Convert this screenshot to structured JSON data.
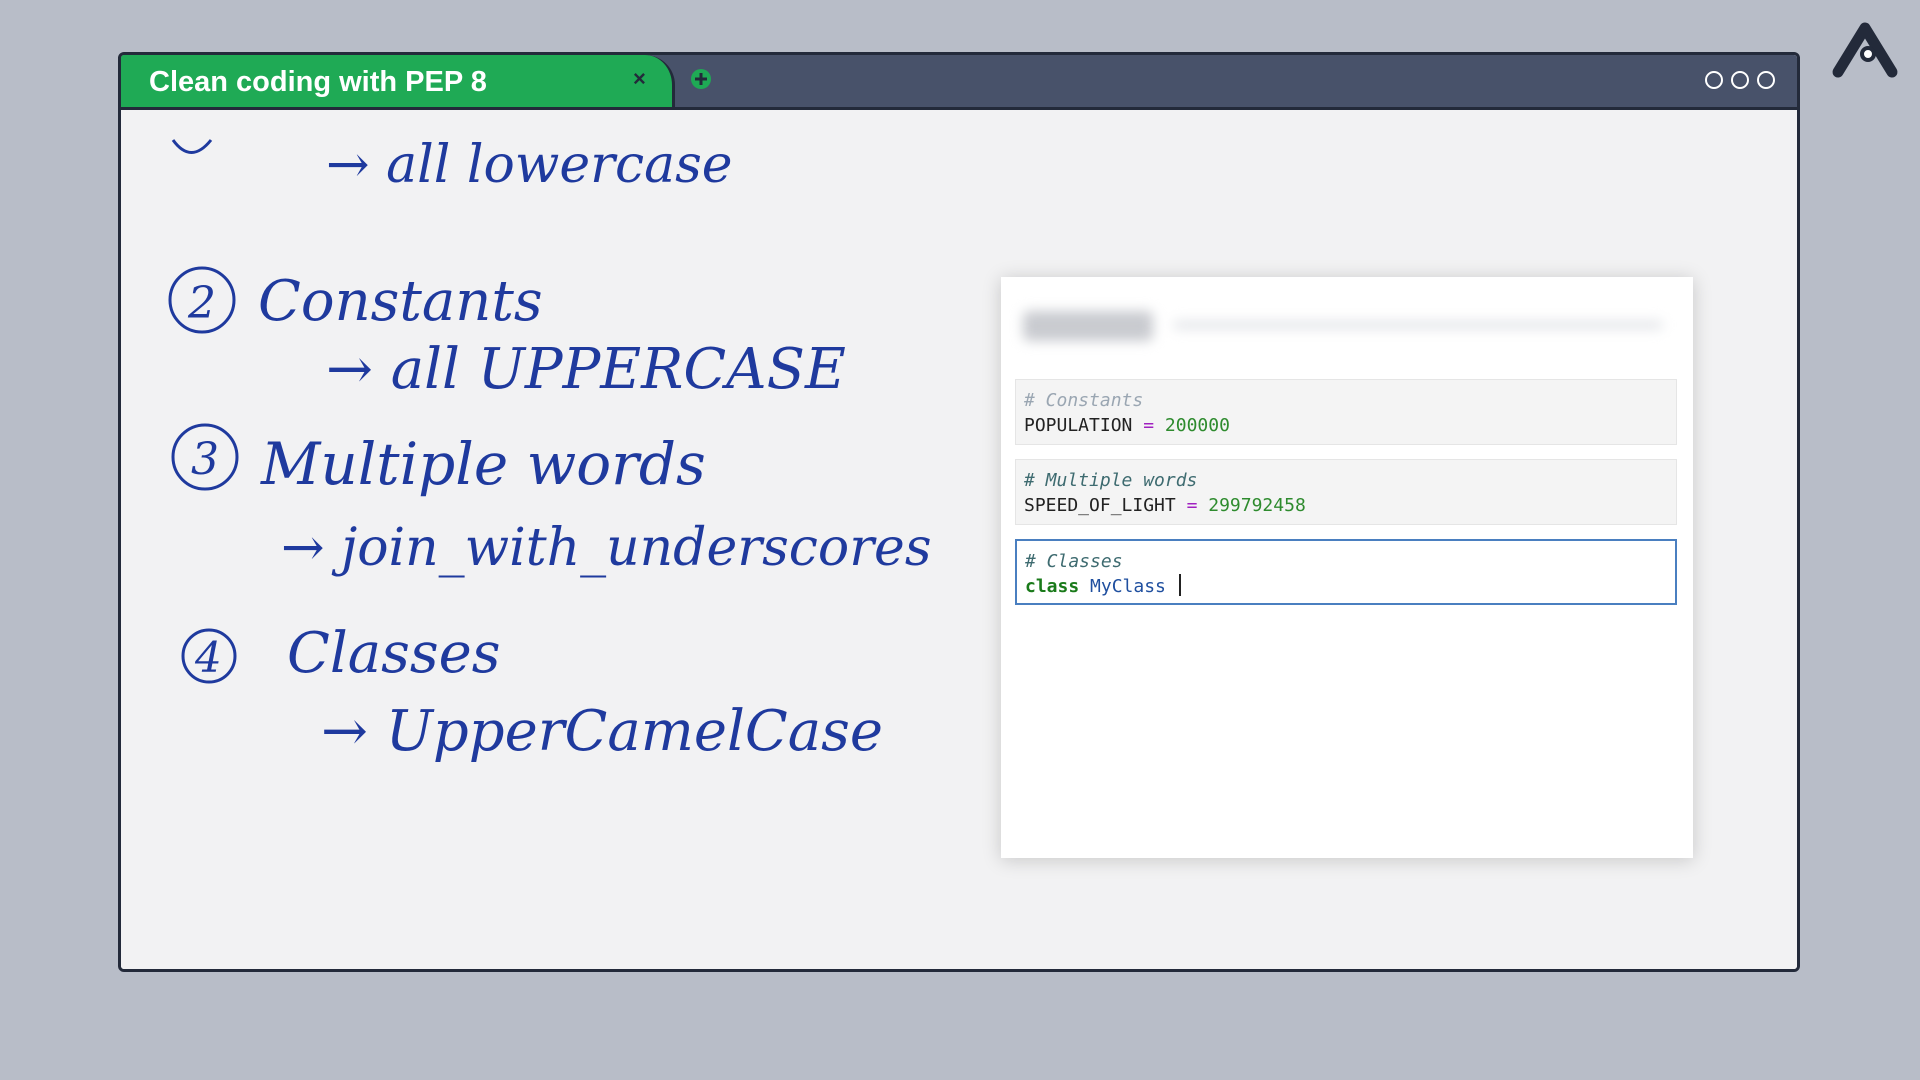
{
  "window": {
    "tab_title": "Clean coding with PEP 8",
    "tab_close": "×"
  },
  "handwriting": {
    "line1": "→ all lowercase",
    "item2_number": "2",
    "item2_title": "Constants",
    "item2_rule": "→ all UPPERCASE",
    "item3_number": "3",
    "item3_title": "Multiple words",
    "item3_rule": "→ join_with_underscores",
    "item4_number": "4",
    "item4_title": "Classes",
    "item4_rule": "→ UpperCamelCase"
  },
  "notebook": {
    "cells": [
      {
        "comment": "# Constants",
        "name": "POPULATION",
        "op": "=",
        "value": "200000"
      },
      {
        "comment": "# Multiple words",
        "name": "SPEED_OF_LIGHT",
        "op": "=",
        "value": "299792458"
      },
      {
        "comment": "# Classes",
        "keyword": "class",
        "name": "MyClass"
      }
    ]
  },
  "colors": {
    "tab": "#1faa55",
    "titlebar": "#48526a",
    "ink": "#1f3a9e",
    "background": "#b8bdc8"
  }
}
